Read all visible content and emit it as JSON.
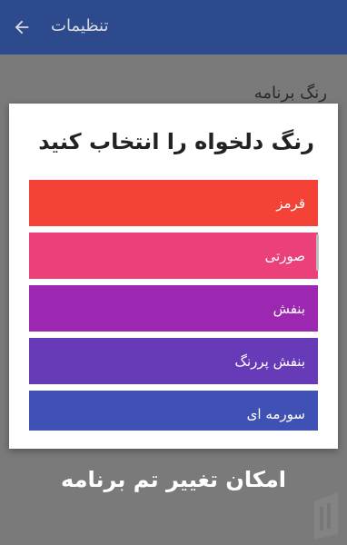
{
  "appbar": {
    "title": "تنظیمات",
    "back_icon": "arrow-back-icon",
    "color": "#2d4a8c"
  },
  "background_screen": {
    "section_label": "رنگ برنامه"
  },
  "dialog": {
    "title": "رنگ دلخواه را انتخاب کنید",
    "colors": [
      {
        "label": "قرمز",
        "color": "#f44336"
      },
      {
        "label": "صورتی",
        "color": "#ec407a"
      },
      {
        "label": "بنفش",
        "color": "#9c27b0"
      },
      {
        "label": "بنفش پررنگ",
        "color": "#673ab7"
      },
      {
        "label": "سورمه ای",
        "color": "#3f51b5"
      }
    ]
  },
  "caption": "امکان تغییر تم برنامه"
}
